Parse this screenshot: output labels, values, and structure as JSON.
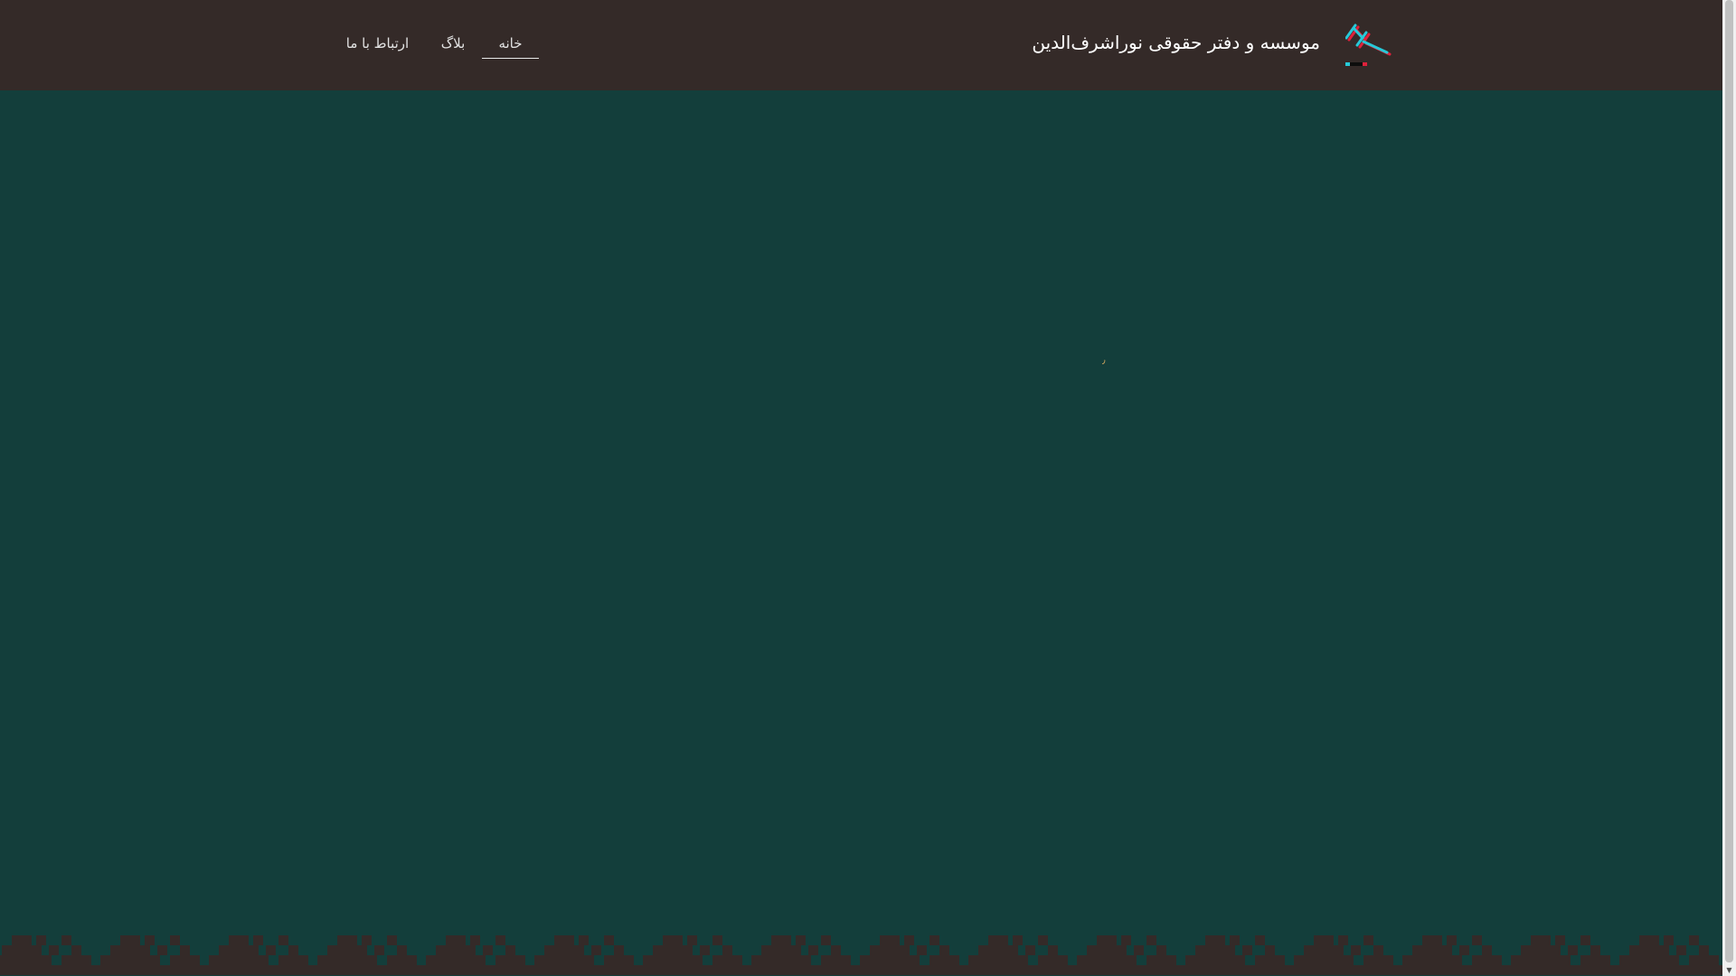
{
  "header": {
    "site_title": "موسسه و دفتر حقوقی نوراشرف‌الدین",
    "logo_icon": "gavel-icon",
    "nav": {
      "home": "خانه",
      "blog": "بلاگ",
      "contact": "ارتباط با ما"
    }
  },
  "main": {
    "loader_mark": "٫"
  },
  "colors": {
    "header_bg": "#342a28",
    "body_bg": "#133e3b",
    "nav_text": "#e2e2e2",
    "accent": "#cda55f",
    "logo_cyan": "#27c9d8",
    "logo_red": "#e0213b"
  },
  "scrollbar": {
    "down_arrow": "▼"
  }
}
